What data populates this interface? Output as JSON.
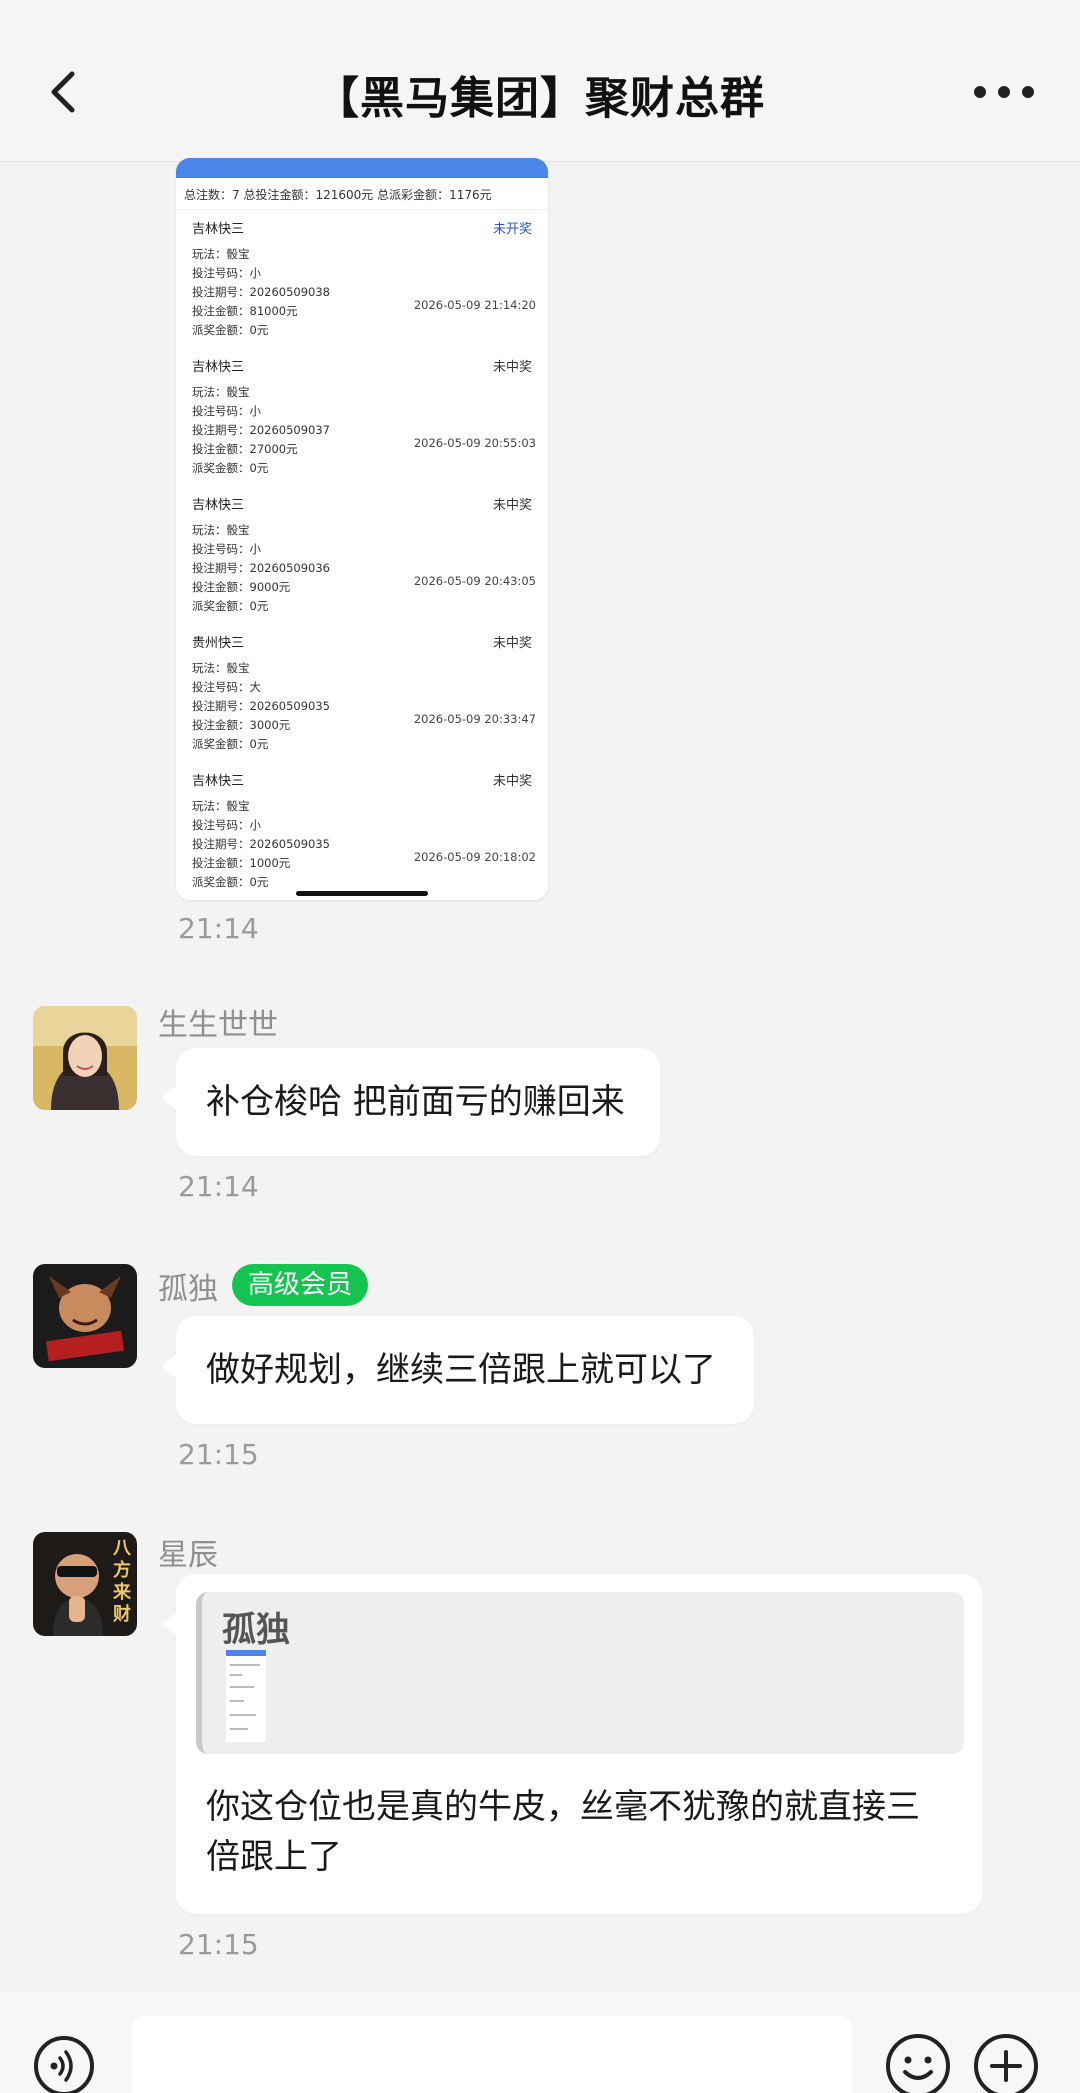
{
  "header": {
    "title": "【黑马集团】聚财总群",
    "back_icon": "chevron-left-icon",
    "more_icon": "more-horizontal-icon"
  },
  "screenshot": {
    "summary": "总注数：7  总投注金额：121600元  总派彩金额：1176元",
    "records": [
      {
        "name": "吉林快三",
        "status": "未开奖",
        "play": "玩法：骰宝",
        "code": "投注号码：小",
        "issue": "投注期号：20260509038",
        "amount": "投注金额：81000元",
        "time": "2026-05-09 21:14:20",
        "payout": "派奖金额：0元"
      },
      {
        "name": "吉林快三",
        "status": "未中奖",
        "play": "玩法：骰宝",
        "code": "投注号码：小",
        "issue": "投注期号：20260509037",
        "amount": "投注金额：27000元",
        "time": "2026-05-09 20:55:03",
        "payout": "派奖金额：0元"
      },
      {
        "name": "吉林快三",
        "status": "未中奖",
        "play": "玩法：骰宝",
        "code": "投注号码：小",
        "issue": "投注期号：20260509036",
        "amount": "投注金额：9000元",
        "time": "2026-05-09 20:43:05",
        "payout": "派奖金额：0元"
      },
      {
        "name": "贵州快三",
        "status": "未中奖",
        "play": "玩法：骰宝",
        "code": "投注号码：大",
        "issue": "投注期号：20260509035",
        "amount": "投注金额：3000元",
        "time": "2026-05-09 20:33:47",
        "payout": "派奖金额：0元"
      },
      {
        "name": "吉林快三",
        "status": "未中奖",
        "play": "玩法：骰宝",
        "code": "投注号码：小",
        "issue": "投注期号：20260509035",
        "amount": "投注金额：1000元",
        "time": "2026-05-09 20:18:02",
        "payout": "派奖金额：0元"
      }
    ]
  },
  "messages": {
    "time1": "21:14",
    "m2": {
      "sender": "生生世世",
      "text": "补仓梭哈 把前面亏的赚回来",
      "time": "21:14"
    },
    "m3": {
      "sender": "孤独",
      "badge": "高级会员",
      "text": "做好规划，继续三倍跟上就可以了",
      "time": "21:15"
    },
    "m4": {
      "sender": "星辰",
      "quote_name": "孤独",
      "text": "你这仓位也是真的牛皮，丝毫不犹豫的就直接三倍跟上了",
      "time": "21:15",
      "avatar_text": "八方来财"
    }
  },
  "input": {
    "placeholder": "",
    "voice_icon": "voice-icon",
    "emoji_icon": "emoji-icon",
    "plus_icon": "plus-circle-icon"
  },
  "colors": {
    "badge_green": "#16c452",
    "screenshot_blue": "#4a86e8",
    "status_open": "#2b55d6"
  }
}
